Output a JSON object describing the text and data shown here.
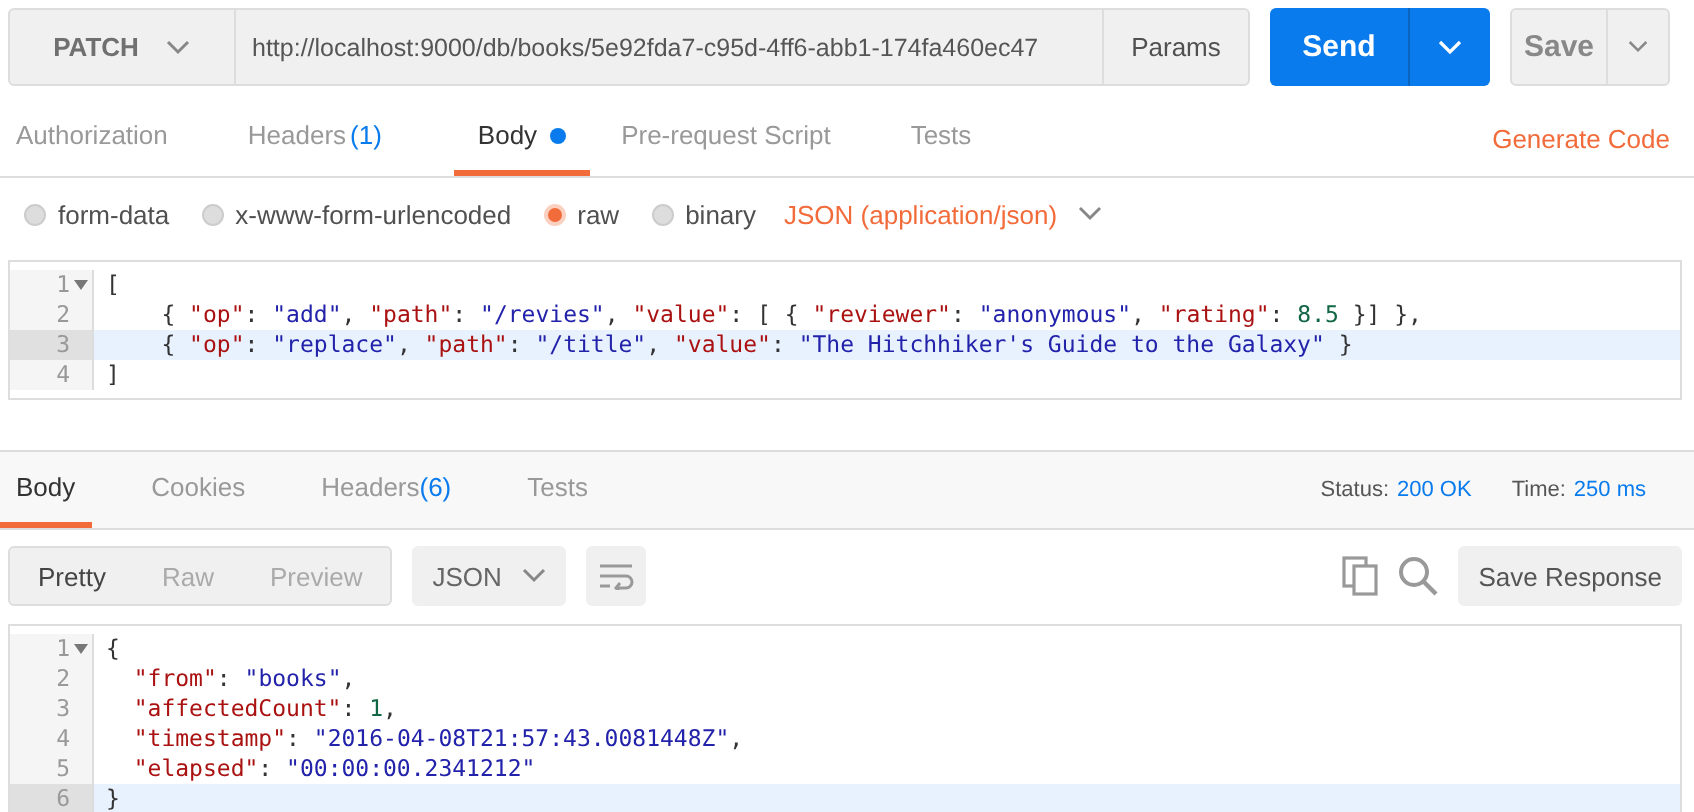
{
  "request": {
    "method": "PATCH",
    "url": "http://localhost:9000/db/books/5e92fda7-c95d-4ff6-abb1-174fa460ec47",
    "params_label": "Params",
    "send_label": "Send",
    "save_label": "Save"
  },
  "request_tabs": [
    {
      "label": "Authorization",
      "dot": false,
      "selected": false
    },
    {
      "label": "Headers",
      "count": "(1)",
      "dot": false,
      "selected": false
    },
    {
      "label": "Body",
      "dot": true,
      "selected": true
    },
    {
      "label": "Pre-request Script",
      "dot": false,
      "selected": false
    },
    {
      "label": "Tests",
      "dot": false,
      "selected": false
    }
  ],
  "generate_code": "Generate Code",
  "body_modes": [
    {
      "label": "form-data",
      "selected": false
    },
    {
      "label": "x-www-form-urlencoded",
      "selected": false
    },
    {
      "label": "raw",
      "selected": true
    },
    {
      "label": "binary",
      "selected": false
    }
  ],
  "content_type": "JSON (application/json)",
  "request_body": [
    {
      "number": "1",
      "text": "[",
      "foldable": true,
      "active": false
    },
    {
      "number": "2",
      "text": "    { \"op\": \"add\", \"path\": \"/revies\", \"value\": [ { \"reviewer\": \"anonymous\", \"rating\": 8.5 }] },",
      "foldable": false,
      "active": false
    },
    {
      "number": "3",
      "text": "    { \"op\": \"replace\", \"path\": \"/title\", \"value\": \"The Hitchhiker's Guide to the Galaxy\" }",
      "foldable": false,
      "active": true
    },
    {
      "number": "4",
      "text": "]",
      "foldable": false,
      "active": false
    }
  ],
  "response_tabs": [
    {
      "label": "Body",
      "selected": true
    },
    {
      "label": "Cookies",
      "selected": false
    },
    {
      "label": "Headers",
      "count": "(6)",
      "selected": false
    },
    {
      "label": "Tests",
      "selected": false
    }
  ],
  "status": {
    "label": "Status:",
    "value": "200 OK"
  },
  "time": {
    "label": "Time:",
    "value": "250 ms"
  },
  "view_modes": [
    {
      "label": "Pretty",
      "selected": true
    },
    {
      "label": "Raw",
      "selected": false
    },
    {
      "label": "Preview",
      "selected": false
    }
  ],
  "format": "JSON",
  "save_response": "Save Response",
  "response_body": [
    {
      "number": "1",
      "text": "{",
      "foldable": true,
      "active": false
    },
    {
      "number": "2",
      "text": "  \"from\": \"books\",",
      "foldable": false,
      "active": false
    },
    {
      "number": "3",
      "text": "  \"affectedCount\": 1,",
      "foldable": false,
      "active": false
    },
    {
      "number": "4",
      "text": "  \"timestamp\": \"2016-04-08T21:57:43.0081448Z\",",
      "foldable": false,
      "active": false
    },
    {
      "number": "5",
      "text": "  \"elapsed\": \"00:00:00.2341212\"",
      "foldable": false,
      "active": false
    },
    {
      "number": "6",
      "text": "}",
      "foldable": false,
      "active": true
    }
  ]
}
